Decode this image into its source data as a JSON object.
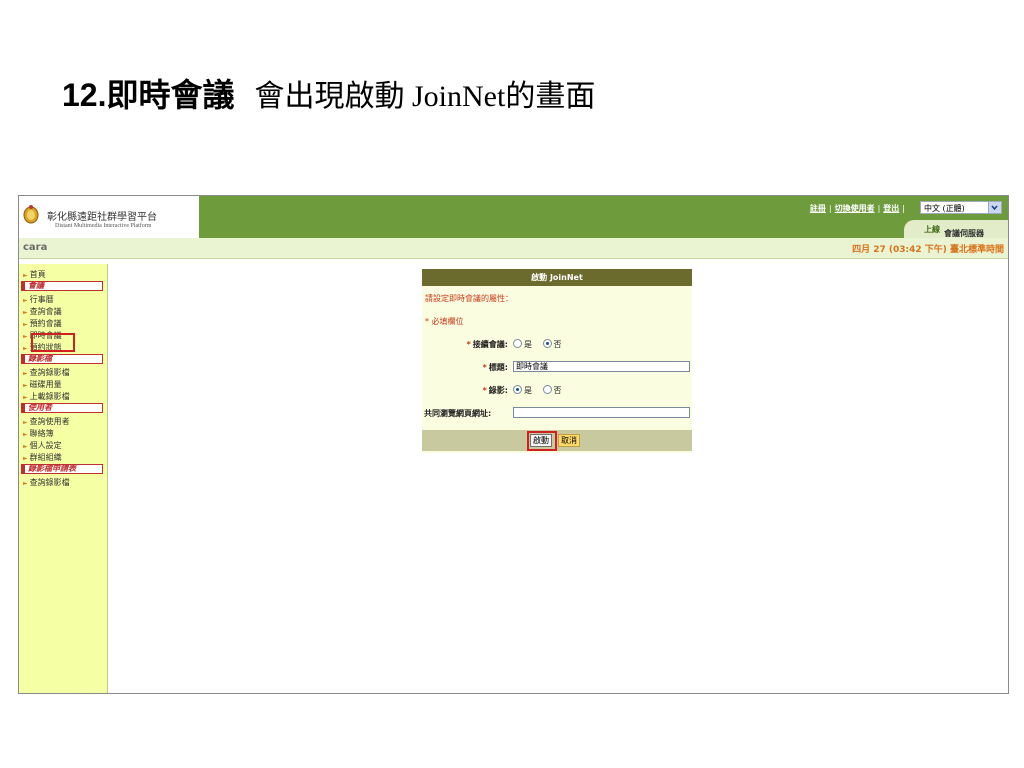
{
  "slide": {
    "number": "12.",
    "title": "即時會議",
    "subtitle": "會出現啟動 JoinNet的畫面"
  },
  "header": {
    "logo_name": "彰化縣遠距社群學習平台",
    "logo_subtitle": "Distant Multimedia Interactive Platform",
    "links": [
      "註冊",
      "切換使用者",
      "登出"
    ],
    "language_selected": "中文 (正體)",
    "meeting_server_label": "會議伺服器",
    "meeting_server_status": "上線"
  },
  "userbar": {
    "username": "cara",
    "datetime": "四月 27 (03:42 下午) 臺北標準時間"
  },
  "sidebar": {
    "items": [
      {
        "type": "link",
        "label": "首頁"
      },
      {
        "type": "section",
        "label": "會議"
      },
      {
        "type": "link",
        "label": "行事曆"
      },
      {
        "type": "link",
        "label": "查詢會議"
      },
      {
        "type": "link",
        "label": "預約會議"
      },
      {
        "type": "link",
        "label": "即時會議",
        "highlighted": true
      },
      {
        "type": "link",
        "label": "預約狀態"
      },
      {
        "type": "section",
        "label": "錄影檔"
      },
      {
        "type": "link",
        "label": "查詢錄影檔"
      },
      {
        "type": "link",
        "label": "磁碟用量"
      },
      {
        "type": "link",
        "label": "上載錄影檔"
      },
      {
        "type": "section",
        "label": "使用者"
      },
      {
        "type": "link",
        "label": "查詢使用者"
      },
      {
        "type": "link",
        "label": "聯絡簿"
      },
      {
        "type": "link",
        "label": "個人設定"
      },
      {
        "type": "link",
        "label": "群組組織"
      },
      {
        "type": "section",
        "label": "錄影檔申請表"
      },
      {
        "type": "link",
        "label": "查詢錄影檔"
      }
    ]
  },
  "dialog": {
    "title": "啟動 JoinNet",
    "instruction": "請設定即時會議的屬性：",
    "required_note": "* 必填欄位",
    "fields": {
      "continue_meeting": {
        "label": "接續會議:",
        "options": [
          "是",
          "否"
        ],
        "selected": "否"
      },
      "subject": {
        "label": "標題:",
        "value": "即時會議"
      },
      "record": {
        "label": "錄影:",
        "options": [
          "是",
          "否"
        ],
        "selected": "是"
      },
      "cobrowse_url": {
        "label": "共同瀏覽網頁網址:",
        "value": ""
      }
    },
    "start_button": "啟動",
    "cancel_button": "取消"
  }
}
